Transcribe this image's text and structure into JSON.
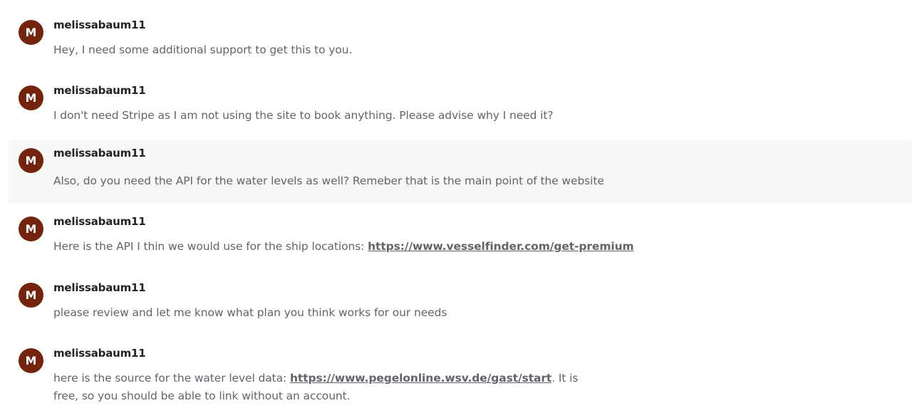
{
  "colors": {
    "avatar_bg": "#74230d",
    "username": "#222325",
    "message_text": "#62646a",
    "hover_bg": "#f7f7f7"
  },
  "messages": [
    {
      "avatar_initial": "M",
      "username": "melissabaum11",
      "text": "Hey, I need some additional support to get this to you."
    },
    {
      "avatar_initial": "M",
      "username": "melissabaum11",
      "text": "I don't need Stripe as I am not using the site to book anything. Please advise why I need it?"
    },
    {
      "avatar_initial": "M",
      "username": "melissabaum11",
      "text": "Also, do you need the API for the water levels as well? Remeber that is the main point of the website"
    },
    {
      "avatar_initial": "M",
      "username": "melissabaum11",
      "text_before": "Here is the API I thin we would use for the ship locations: ",
      "link": "https://www.vesselfinder.com/get-premium"
    },
    {
      "avatar_initial": "M",
      "username": "melissabaum11",
      "text": "please review and let me know what plan you think works for our needs"
    },
    {
      "avatar_initial": "M",
      "username": "melissabaum11",
      "text_before": "here is the source for the water level data: ",
      "link": "https://www.pegelonline.wsv.de/gast/start",
      "text_after": ". It is free, so you should be able to link without an account."
    }
  ]
}
